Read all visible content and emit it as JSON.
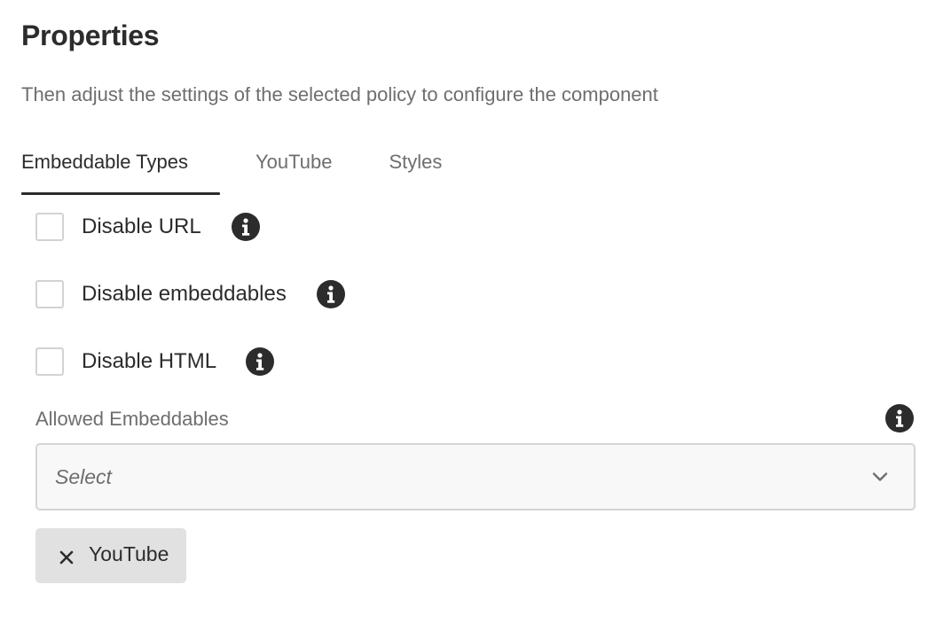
{
  "heading": "Properties",
  "description": "Then adjust the settings of the selected policy to configure the component",
  "tabs": [
    {
      "label": "Embeddable Types",
      "active": true
    },
    {
      "label": "YouTube",
      "active": false
    },
    {
      "label": "Styles",
      "active": false
    }
  ],
  "checkboxes": [
    {
      "label": "Disable URL",
      "checked": false,
      "icon": "info-icon"
    },
    {
      "label": "Disable embeddables",
      "checked": false,
      "icon": "info-icon"
    },
    {
      "label": "Disable HTML",
      "checked": false,
      "icon": "info-icon"
    }
  ],
  "allowed_embeddables": {
    "label": "Allowed Embeddables",
    "placeholder": "Select",
    "icon": "chevron-down-icon",
    "selected_tags": [
      {
        "label": "YouTube",
        "icon": "close-icon"
      }
    ]
  },
  "colors": {
    "text": "#2c2c2c",
    "muted_text": "#6e6e6e",
    "tag_background": "#e1e1e1",
    "select_background": "#f8f8f8"
  }
}
